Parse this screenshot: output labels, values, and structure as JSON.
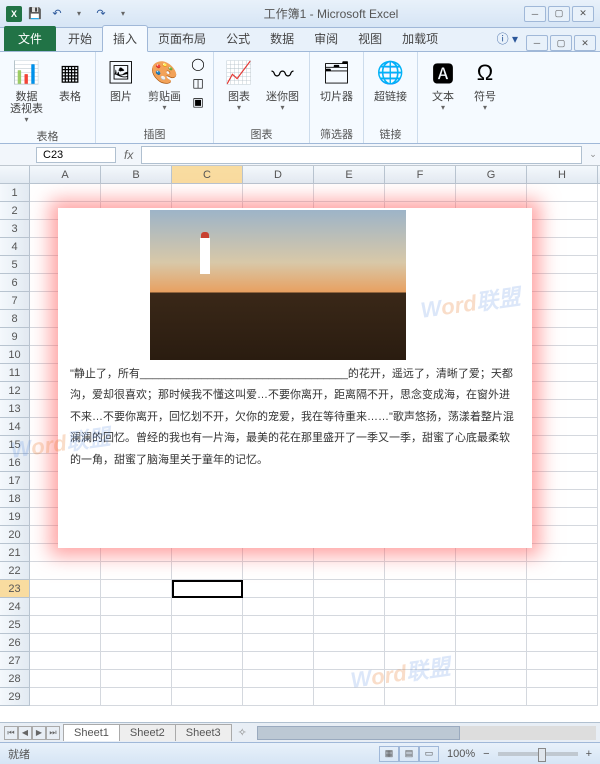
{
  "title": "工作簿1 - Microsoft Excel",
  "qat": {
    "save": "💾",
    "undo": "↶",
    "redo": "↷"
  },
  "tabs": {
    "file": "文件",
    "home": "开始",
    "insert": "插入",
    "pagelayout": "页面布局",
    "formulas": "公式",
    "data": "数据",
    "review": "审阅",
    "view": "视图",
    "addins": "加载项"
  },
  "ribbon": {
    "tables": {
      "label": "表格",
      "pivot": "数据\n透视表",
      "table": "表格"
    },
    "illustrations": {
      "label": "插图",
      "picture": "图片",
      "clipart": "剪贴画"
    },
    "charts": {
      "label": "图表",
      "chart": "图表",
      "sparkline": "迷你图"
    },
    "filter": {
      "label": "筛选器",
      "slicer": "切片器"
    },
    "links": {
      "label": "链接",
      "hyperlink": "超链接"
    },
    "text": {
      "text": "文本",
      "symbol": "符号"
    }
  },
  "namebox": "C23",
  "formula_fx": "fx",
  "columns": [
    "A",
    "B",
    "C",
    "D",
    "E",
    "F",
    "G",
    "H"
  ],
  "active_cell": {
    "row": 23,
    "col": "C"
  },
  "overlay_text": "\"静止了，所有__________________________________的花开，遥远了，清晰了爱；天都沟，爱却很喜欢；那时候我不懂这叫爱…不要你离开，距离隔不开，思念变成海，在窗外进不来…不要你离开，回忆划不开，欠你的宠爱，我在等待重来……\"歌声悠扬，荡漾着整片混澜澜的回忆。曾经的我也有一片海，最美的花在那里盛开了一季又一季，甜蜜了心底最柔软的一角，甜蜜了脑海里关于童年的记忆。",
  "sheets": {
    "s1": "Sheet1",
    "s2": "Sheet2",
    "s3": "Sheet3"
  },
  "status": {
    "ready": "就绪",
    "zoom": "100%"
  },
  "watermark": "Word联盟"
}
